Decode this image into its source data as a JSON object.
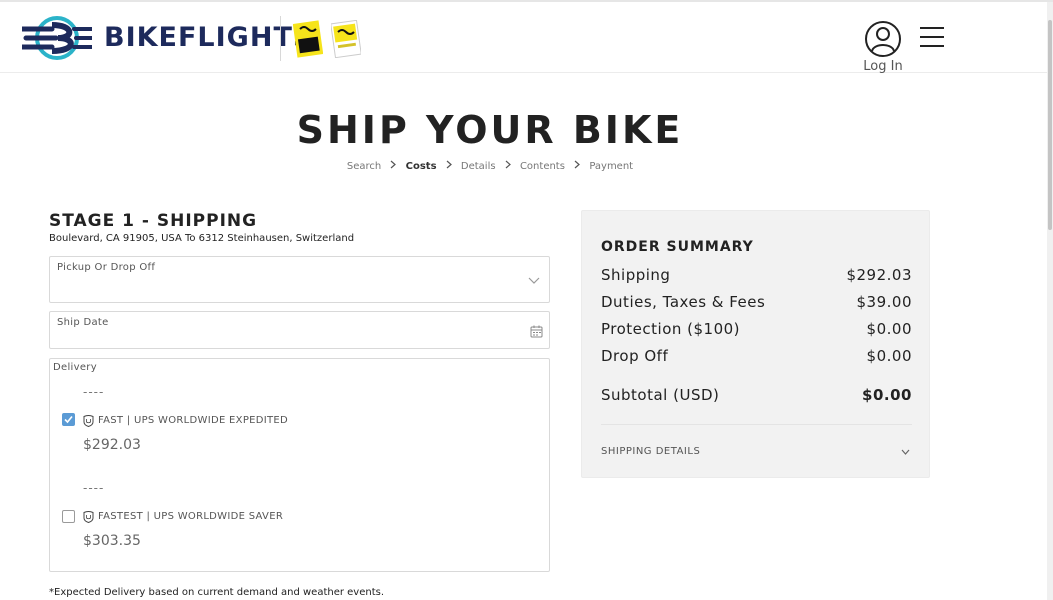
{
  "header": {
    "brand": "BIKEFLIGHTS",
    "login_label": "Log In",
    "colors": {
      "brand_navy": "#1d2a5c",
      "brand_teal": "#2bb3c9",
      "tdf_yellow": "#f6e41b"
    }
  },
  "page": {
    "title": "SHIP YOUR BIKE",
    "breadcrumb": [
      "Search",
      "Costs",
      "Details",
      "Contents",
      "Payment"
    ],
    "breadcrumb_active": "Costs"
  },
  "stage": {
    "title": "STAGE 1 - SHIPPING",
    "route": "Boulevard, CA 91905, USA To 6312 Steinhausen, Switzerland"
  },
  "form": {
    "pickup_label": "Pickup Or Drop Off",
    "pickup_value": "",
    "ship_date_label": "Ship Date",
    "ship_date_value": "",
    "delivery_label": "Delivery",
    "options": [
      {
        "date": "----",
        "label": "FAST | UPS WORLDWIDE EXPEDITED",
        "price": "$292.03",
        "checked": true
      },
      {
        "date": "----",
        "label": "FASTEST | UPS WORLDWIDE SAVER",
        "price": "$303.35",
        "checked": false
      }
    ]
  },
  "footnote": "*Expected Delivery based on current demand and weather events.",
  "summary": {
    "title": "ORDER SUMMARY",
    "rows": [
      {
        "label": "Shipping",
        "value": "$292.03"
      },
      {
        "label": "Duties, Taxes & Fees",
        "value": "$39.00"
      },
      {
        "label": "Protection ($100)",
        "value": "$0.00"
      },
      {
        "label": "Drop Off",
        "value": "$0.00"
      }
    ],
    "subtotal_label": "Subtotal (USD)",
    "subtotal_value": "$0.00",
    "details_label": "SHIPPING DETAILS"
  }
}
